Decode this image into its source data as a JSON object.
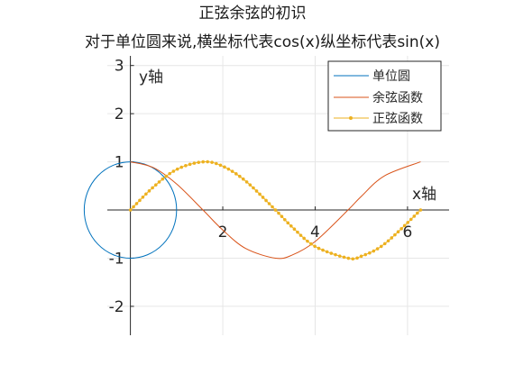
{
  "chart_data": {
    "type": "line",
    "title": "正弦余弦的初识",
    "subtitle": "对于单位圆来说,横坐标代表cos(x)纵坐标代表sin(x)",
    "xlabel": "x轴",
    "ylabel": "y轴",
    "xlim": [
      -0.5,
      6.9
    ],
    "ylim": [
      -2.6,
      3.2
    ],
    "xticks": [
      2,
      4,
      6
    ],
    "yticks": [
      3,
      2,
      1,
      -1,
      -2
    ],
    "grid": true,
    "legend_position": "top-right",
    "series": [
      {
        "name": "单位圆",
        "kind": "circle",
        "color": "#0072bd",
        "center": [
          0,
          0
        ],
        "radius": 1
      },
      {
        "name": "余弦函数",
        "kind": "function",
        "color": "#d95319",
        "x": [
          0,
          0.5,
          1.0,
          1.5708,
          2.0,
          2.5,
          3.1416,
          3.5,
          4.0,
          4.7124,
          5.0,
          5.5,
          6.2832
        ],
        "values": [
          1.0,
          0.878,
          0.54,
          0.0,
          -0.416,
          -0.801,
          -1.0,
          -0.936,
          -0.654,
          0.0,
          0.284,
          0.709,
          1.0
        ]
      },
      {
        "name": "正弦函数",
        "kind": "function",
        "color": "#edb120",
        "marker": "dot",
        "x": [
          0,
          0.5,
          1.0,
          1.5708,
          2.0,
          2.5,
          3.1416,
          3.5,
          4.0,
          4.7124,
          5.0,
          5.5,
          6.2832
        ],
        "values": [
          0.0,
          0.479,
          0.841,
          1.0,
          0.909,
          0.598,
          0.0,
          -0.351,
          -0.757,
          -1.0,
          -0.959,
          -0.706,
          0.0
        ]
      }
    ]
  }
}
